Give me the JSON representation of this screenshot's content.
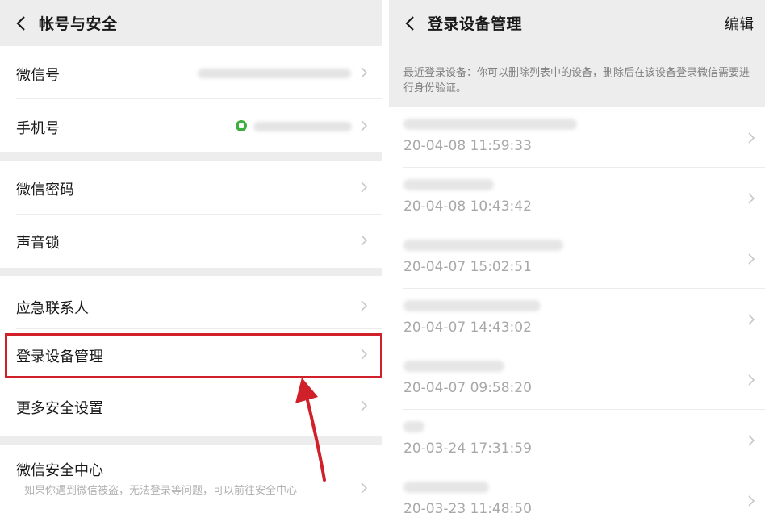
{
  "left": {
    "nav": {
      "title": "帐号与安全"
    },
    "rows": {
      "wechat_id": {
        "label": "微信号"
      },
      "phone": {
        "label": "手机号"
      },
      "password": {
        "label": "微信密码"
      },
      "voice_lock": {
        "label": "声音锁"
      },
      "emergency": {
        "label": "应急联系人"
      },
      "devices": {
        "label": "登录设备管理"
      },
      "more": {
        "label": "更多安全设置"
      },
      "center": {
        "label": "微信安全中心",
        "desc": "如果你遇到微信被盗，无法登录等问题，可以前往安全中心"
      }
    },
    "colors": {
      "highlight": "#d0212b",
      "lock": "#3fae3f"
    }
  },
  "right": {
    "nav": {
      "title": "登录设备管理",
      "edit_label": "编辑"
    },
    "notice": "最近登录设备：你可以删除列表中的设备，删除后在该设备登录微信需要进行身份验证。",
    "devices": [
      {
        "time": "20-04-08 11:59:33"
      },
      {
        "time": "20-04-08 10:43:42"
      },
      {
        "time": "20-04-07 15:02:51"
      },
      {
        "time": "20-04-07 14:43:02"
      },
      {
        "time": "20-04-07 09:58:20"
      },
      {
        "time": "20-03-24 17:31:59"
      },
      {
        "time": "20-03-23 11:48:50"
      }
    ]
  },
  "icons": [
    "back-chevron-icon",
    "chevron-right-icon",
    "lock-icon",
    "arrow-annotation"
  ]
}
